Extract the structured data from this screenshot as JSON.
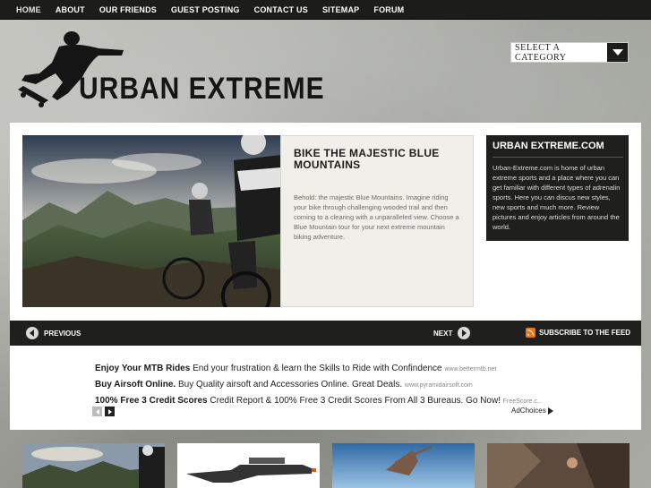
{
  "nav": {
    "items": [
      "HOME",
      "ABOUT",
      "OUR FRIENDS",
      "GUEST POSTING",
      "CONTACT US",
      "SITEMAP",
      "FORUM"
    ]
  },
  "header": {
    "logo_text": "URBAN EXTREME",
    "category_select": "SELECT A CATEGORY"
  },
  "feature": {
    "title": "BIKE THE MAJESTIC BLUE MOUNTAINS",
    "body": "Behold: the majestic Blue Mountains. Imagine riding your bike through challenging wooded trail and then coming to a clearing with a unparalleled view. Choose a Blue Mountain tour for your next extreme mountain biking adventure."
  },
  "about": {
    "title": "URBAN EXTREME.COM",
    "body": "Urban-Extreme.com is home of urban extreme sports and a place where you can get familiar with different types of adrenalin sports. Here you can discus new styles, new sports and much more. Review pictures and enjoy articles from around the world."
  },
  "slider": {
    "previous": "PREVIOUS",
    "next": "NEXT",
    "subscribe": "SUBSCRIBE TO THE FEED"
  },
  "ads": [
    {
      "title": "Enjoy Your MTB Rides",
      "text": "End your frustration & learn the Skills to Ride with Confindence",
      "url": "www.bettermtb.net"
    },
    {
      "title": "Buy Airsoft Online.",
      "text": "Buy Quality airsoft and Accessories Online. Great Deals.",
      "url": "www.pyramidairsoft.com"
    },
    {
      "title": "100% Free 3 Credit Scores",
      "text": "Credit Report & 100% Free 3 Credit Scores From All 3 Bureaus. Go Now!",
      "url": "FreeScore.c..."
    }
  ],
  "adchoices": "AdChoices"
}
